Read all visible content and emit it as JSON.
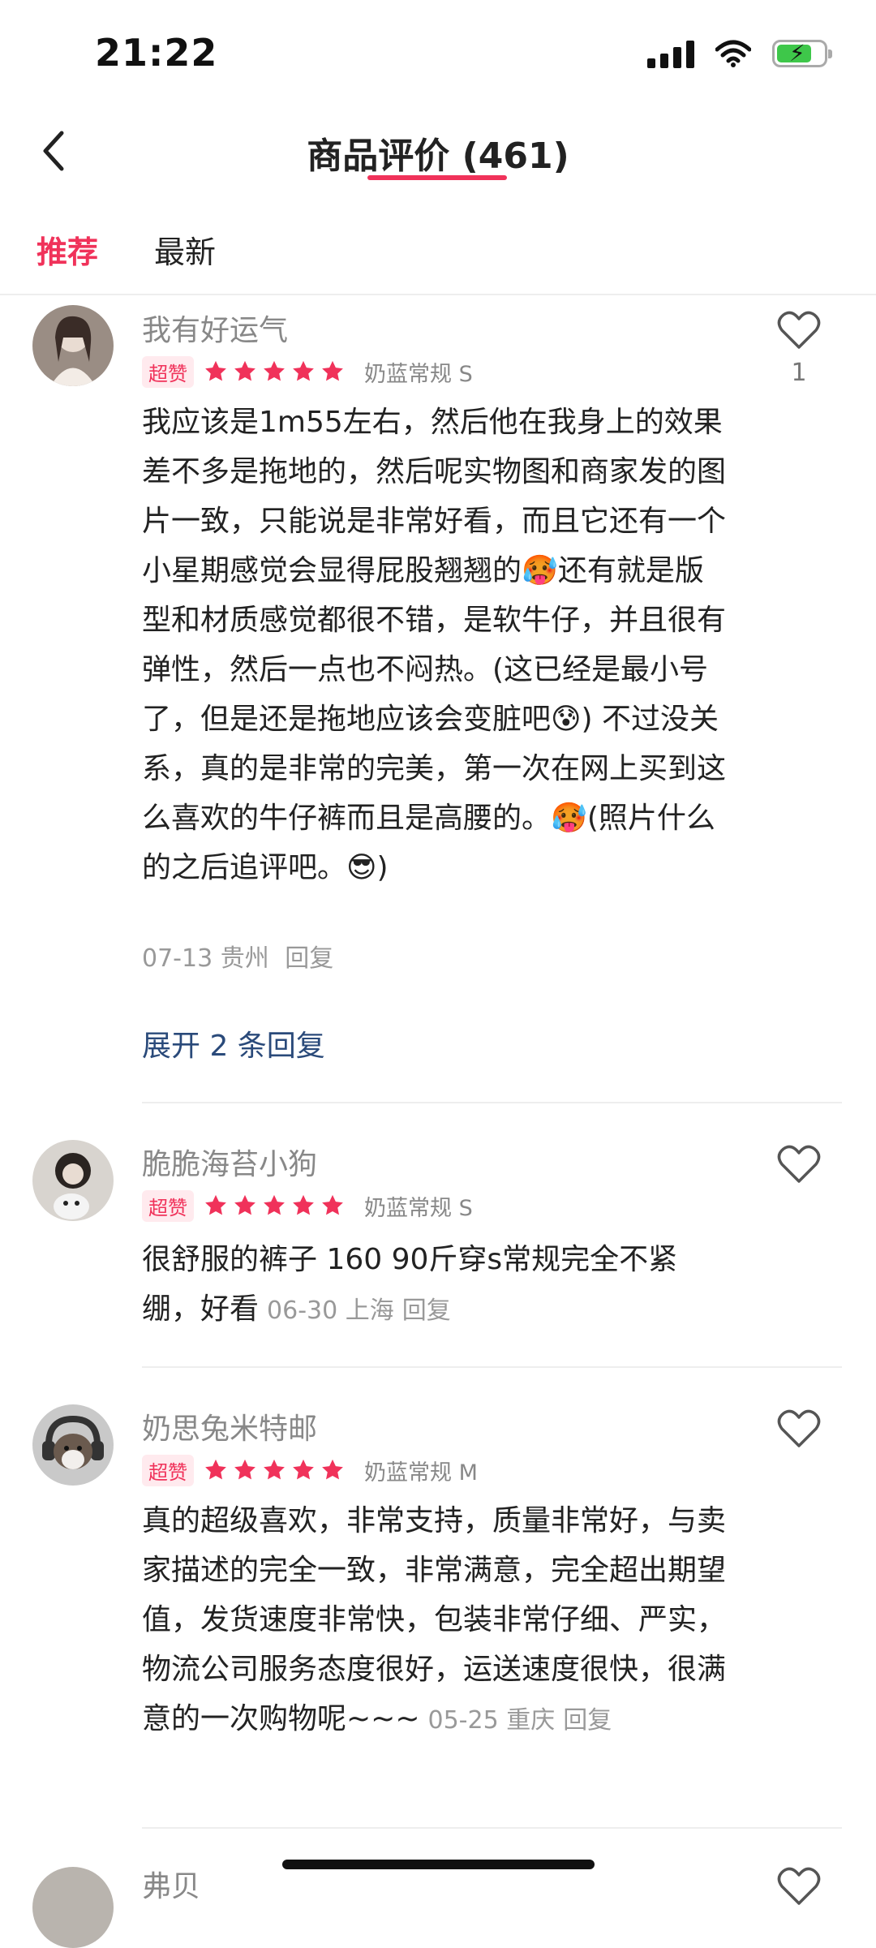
{
  "status": {
    "time": "21:22"
  },
  "header": {
    "title": "商品评价 (461)"
  },
  "tabs": [
    {
      "label": "推荐"
    },
    {
      "label": "最新"
    }
  ],
  "reviews": [
    {
      "user": "我有好运气",
      "badge": "超赞",
      "rating": 5,
      "spec": "奶蓝常规  S",
      "likes": "1",
      "text": "我应该是1m55左右，然后他在我身上的效果差不多是拖地的，然后呢实物图和商家发的图片一致，只能说是非常好看，而且它还有一个小星期感觉会显得屁股翘翘的🥵还有就是版型和材质感觉都很不错，是软牛仔，并且很有弹性，然后一点也不闷热。(这已经是最小号了，但是还是拖地应该会变脏吧😰) 不过没关系，真的是非常的完美，第一次在网上买到这么喜欢的牛仔裤而且是高腰的。🥵(照片什么的之后追评吧。😎)",
      "date": "07-13 贵州",
      "reply": "回复",
      "expand": "展开 2 条回复"
    },
    {
      "user": "脆脆海苔小狗",
      "badge": "超赞",
      "rating": 5,
      "spec": "奶蓝常规  S",
      "text": "很舒服的裤子 160 90斤穿s常规完全不紧绷，好看",
      "date": "06-30 上海",
      "reply": "回复"
    },
    {
      "user": "奶思兔米特邮",
      "badge": "超赞",
      "rating": 5,
      "spec": "奶蓝常规  M",
      "text": "真的超级喜欢，非常支持，质量非常好，与卖家描述的完全一致，非常满意，完全超出期望值，发货速度非常快，包装非常仔细、严实，物流公司服务态度很好，运送速度很快，很满意的一次购物呢~~~",
      "date": "05-25 重庆",
      "reply": "回复"
    },
    {
      "user": "弗贝"
    }
  ],
  "colors": {
    "accent": "#f0325a",
    "link": "#2a4a7a"
  }
}
